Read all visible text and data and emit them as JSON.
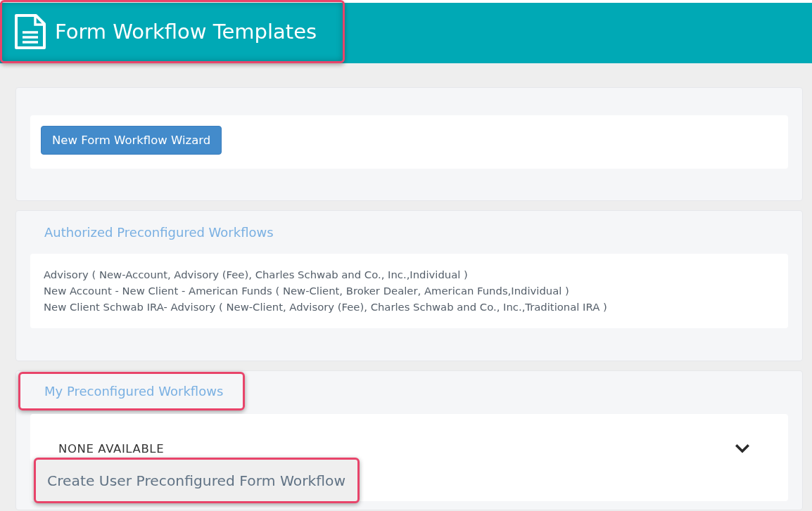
{
  "header": {
    "title": "Form Workflow Templates",
    "highlighted": true
  },
  "sections": [
    {
      "kind": "actions",
      "button": "New Form Workflow Wizard"
    },
    {
      "kind": "list",
      "title": "Authorized Preconfigured Workflows",
      "title_highlighted": false,
      "items": [
        "Advisory ( New-Account, Advisory (Fee), Charles Schwab and Co., Inc.,Individual )",
        "New Account - New Client - American Funds ( New-Client, Broker Dealer, American Funds,Individual )",
        "New Client Schwab IRA- Advisory ( New-Client, Advisory (Fee), Charles Schwab and Co., Inc.,Traditional IRA )"
      ]
    },
    {
      "kind": "collapsible",
      "title": "My Preconfigured Workflows",
      "title_highlighted": true,
      "empty_text": "NONE AVAILABLE",
      "action": {
        "label": "Create User Preconfigured Form Workflow",
        "highlighted": true
      }
    }
  ]
}
